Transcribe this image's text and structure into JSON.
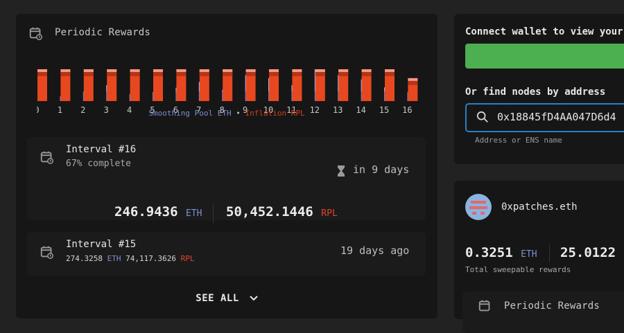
{
  "periodic_rewards": {
    "title": "Periodic Rewards",
    "legend": {
      "eth_label": "Smoothing Pool ETH",
      "separator": "•",
      "rpl_label": "Inflation RPL"
    },
    "chart_data": {
      "type": "bar",
      "categories": [
        "0",
        "1",
        "2",
        "3",
        "4",
        "5",
        "6",
        "7",
        "8",
        "9",
        "10",
        "11",
        "12",
        "13",
        "14",
        "15",
        "16"
      ],
      "series": [
        {
          "name": "Smoothing Pool ETH",
          "values": [
            0.0,
            0.15,
            0.3,
            0.5,
            0.22,
            0.28,
            0.42,
            0.6,
            0.35,
            0.82,
            0.72,
            0.5,
            1.0,
            0.82,
            0.68,
            0.43,
            0.28
          ]
        },
        {
          "name": "Inflation RPL",
          "values": [
            1.0,
            1.0,
            1.0,
            1.0,
            1.0,
            1.0,
            1.0,
            1.0,
            1.0,
            1.0,
            1.0,
            1.0,
            1.0,
            1.0,
            1.0,
            1.0,
            0.72
          ]
        }
      ]
    }
  },
  "interval16": {
    "title": "Interval #16",
    "progress": "67% complete",
    "eta": "in 9 days",
    "eth_value": "246.9436",
    "eth_unit": "ETH",
    "rpl_value": "50,452.1446",
    "rpl_unit": "RPL"
  },
  "interval15": {
    "title": "Interval #15",
    "eth_value": "274.3258",
    "eth_unit": "ETH",
    "rpl_value": "74,117.3626",
    "rpl_unit": "RPL",
    "ago": "19 days ago"
  },
  "see_all": "SEE ALL",
  "connect": {
    "label": "Connect wallet to view your"
  },
  "find": {
    "label": "Or find nodes by address",
    "address_value": "0x18845fD4AA047D6d4",
    "hint": "Address or ENS name"
  },
  "node": {
    "ens": "0xpatches.eth",
    "eth_value": "0.3251",
    "eth_unit": "ETH",
    "rpl_value": "25.0122",
    "caption": "Total sweepable rewards",
    "periodic_title": "Periodic Rewards"
  },
  "colors": {
    "eth_dark": "#6f7fc4",
    "eth_light": "#a9b2e6",
    "rpl": "#e8481f",
    "rpl_dark": "#b83418",
    "rpl_light": "#f29a83",
    "connect_button": "#4caf50",
    "input_border": "#2b7fc4"
  }
}
